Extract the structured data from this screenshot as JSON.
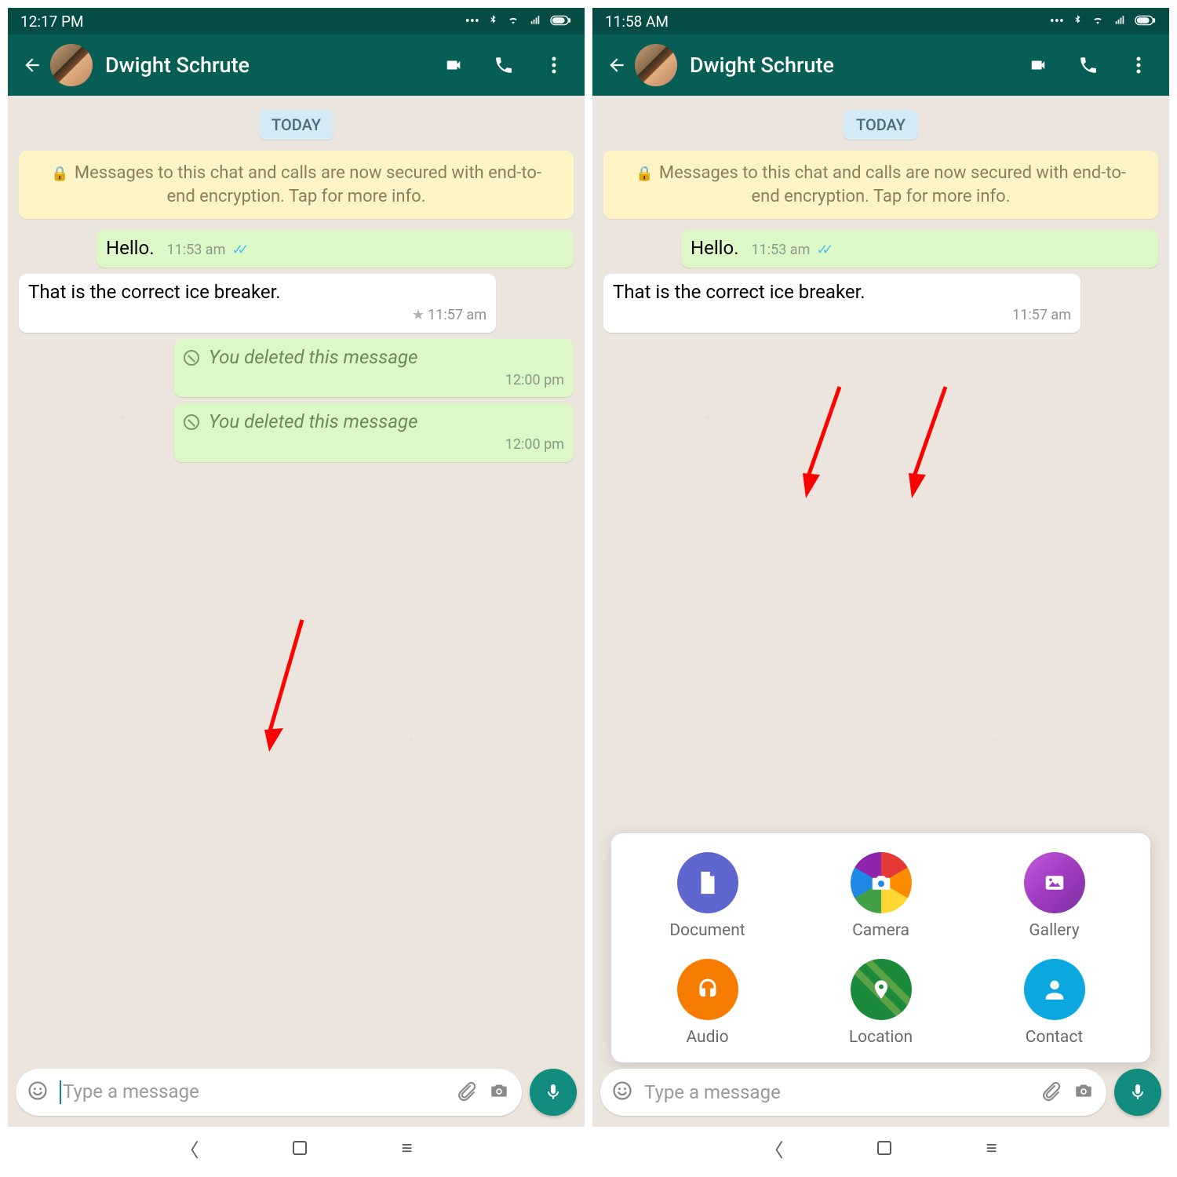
{
  "left": {
    "status_time": "12:17 PM",
    "contact": "Dwight Schrute",
    "date_chip": "TODAY",
    "encryption_banner": "Messages to this chat and calls are now secured with end-to-end encryption. Tap for more info.",
    "messages": [
      {
        "dir": "out",
        "text": "Hello.",
        "time": "11:53 am",
        "status": "read"
      },
      {
        "dir": "in",
        "text": "That is the correct ice breaker.",
        "time": "11:57 am",
        "starred": true
      },
      {
        "dir": "out",
        "deleted": true,
        "text": "You deleted this message",
        "time": "12:00 pm"
      },
      {
        "dir": "out",
        "deleted": true,
        "text": "You deleted this message",
        "time": "12:00 pm"
      }
    ],
    "input_placeholder": "Type a message"
  },
  "right": {
    "status_time": "11:58 AM",
    "contact": "Dwight Schrute",
    "date_chip": "TODAY",
    "encryption_banner": "Messages to this chat and calls are now secured with end-to-end encryption. Tap for more info.",
    "messages": [
      {
        "dir": "out",
        "text": "Hello.",
        "time": "11:53 am",
        "status": "read"
      },
      {
        "dir": "in",
        "text": "That is the correct ice breaker.",
        "time": "11:57 am"
      }
    ],
    "input_placeholder": "Type a message",
    "attach_menu": [
      {
        "key": "document",
        "label": "Document"
      },
      {
        "key": "camera",
        "label": "Camera"
      },
      {
        "key": "gallery",
        "label": "Gallery"
      },
      {
        "key": "audio",
        "label": "Audio"
      },
      {
        "key": "location",
        "label": "Location"
      },
      {
        "key": "contact",
        "label": "Contact"
      }
    ]
  }
}
